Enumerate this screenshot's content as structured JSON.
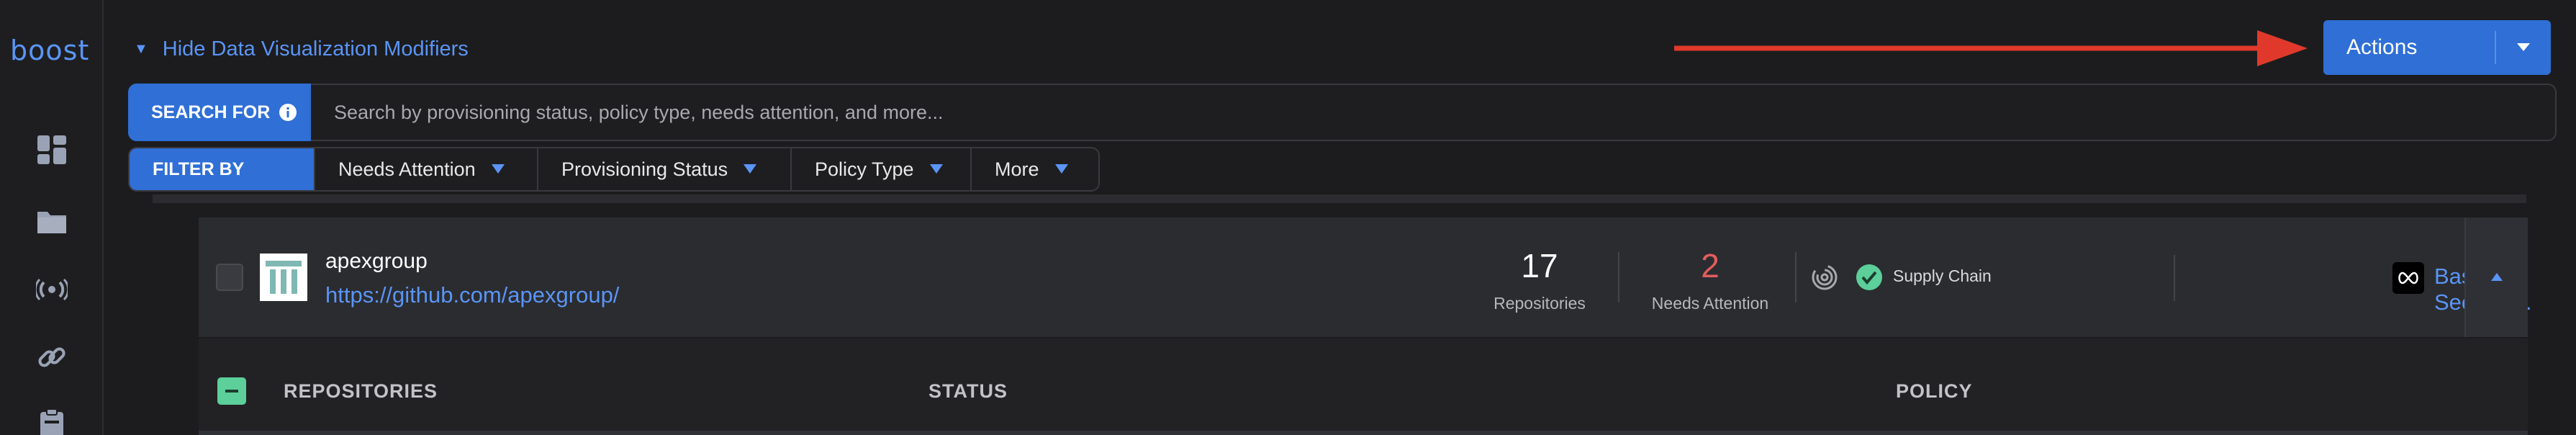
{
  "app": {
    "logo_text": "boost",
    "brand_color": "#5a95f5",
    "accent_color": "#2f6fd6"
  },
  "sidebar": {
    "icons": [
      "dashboard-icon",
      "folder-icon",
      "broadcast-icon",
      "link-icon",
      "clipboard-icon"
    ]
  },
  "toolbar": {
    "hide_modifiers_label": "Hide Data Visualization Modifiers",
    "actions_label": "Actions"
  },
  "search": {
    "label": "SEARCH FOR",
    "placeholder": "Search by provisioning status, policy type, needs attention, and more..."
  },
  "filter": {
    "label": "FILTER BY",
    "items": [
      "Needs Attention",
      "Provisioning Status",
      "Policy Type",
      "More"
    ]
  },
  "org": {
    "name": "apexgroup",
    "url": "https://github.com/apexgroup/",
    "repositories_count": "17",
    "repositories_caption": "Repositories",
    "needs_attention_count": "2",
    "needs_attention_caption": "Needs Attention",
    "supply_chain_label": "Supply Chain",
    "policy_name": "Basic Security...",
    "asterisk": "*"
  },
  "table": {
    "columns": [
      "REPOSITORIES",
      "STATUS",
      "POLICY"
    ]
  },
  "colors": {
    "attention_red": "#e35d5d",
    "success_green": "#5ccf9a",
    "arrow_red": "#e0392b"
  }
}
